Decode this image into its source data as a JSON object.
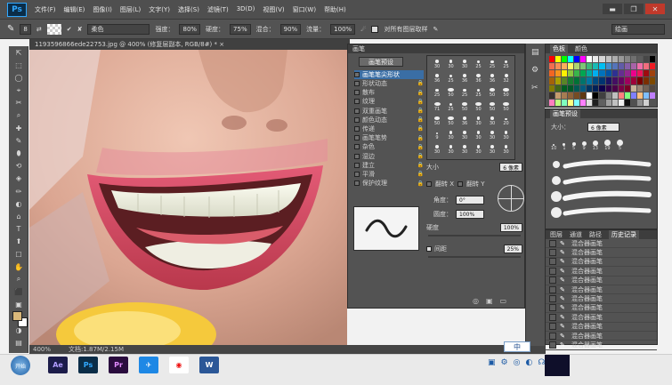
{
  "app": {
    "logo_text": "Ps"
  },
  "menu": [
    "文件(F)",
    "编辑(E)",
    "图像(I)",
    "图层(L)",
    "文字(Y)",
    "选择(S)",
    "滤镜(T)",
    "3D(D)",
    "视图(V)",
    "窗口(W)",
    "帮助(H)"
  ],
  "window_buttons": [
    "▬",
    "❐",
    "✕"
  ],
  "options_bar": {
    "preset_size": "8",
    "mode_value": "柔色",
    "opacity_label": "强度：",
    "opacity_value": "80%",
    "flow_label": "硬度：",
    "flow_value": "75%",
    "strength_label": "混合：",
    "strength_value": "90%",
    "blend_label": "流量：",
    "blend_value": "100%",
    "all_layers_label": "对所有图层取样",
    "workspace_value": "绘画"
  },
  "doc_tab": "1193596866ede22753.jpg @ 400% (修复层副本, RGB/8#) * ×",
  "status": {
    "zoom": "400%",
    "doc": "文档:1.87M/2.15M"
  },
  "brush_panel": {
    "tabs": "画笔",
    "preset_button": "画笔预设",
    "options": [
      {
        "label": "画笔笔尖形状",
        "selected": true,
        "lock": ""
      },
      {
        "label": "形状动态",
        "selected": false,
        "lock": "🔒"
      },
      {
        "label": "散布",
        "selected": false,
        "lock": "🔒"
      },
      {
        "label": "纹理",
        "selected": false,
        "lock": "🔒"
      },
      {
        "label": "双重画笔",
        "selected": false,
        "lock": "🔒"
      },
      {
        "label": "颜色动态",
        "selected": false,
        "lock": "🔒"
      },
      {
        "label": "传递",
        "selected": false,
        "lock": "🔒"
      },
      {
        "label": "画笔笔势",
        "selected": false,
        "lock": "🔒"
      },
      {
        "label": "杂色",
        "selected": false,
        "lock": "🔒"
      },
      {
        "label": "湿边",
        "selected": false,
        "lock": "🔒"
      },
      {
        "label": "建立",
        "selected": false,
        "lock": "🔒"
      },
      {
        "label": "平滑",
        "selected": false,
        "lock": "🔒"
      },
      {
        "label": "保护纹理",
        "selected": false,
        "lock": "🔒"
      }
    ],
    "tip_sizes": [
      "30",
      "30",
      "30",
      "25",
      "25",
      "25",
      "36",
      "25",
      "36",
      "36",
      "36",
      "32",
      "25",
      "50",
      "25",
      "25",
      "50",
      "50",
      "71",
      "25",
      "50",
      "50",
      "50",
      "50",
      "50",
      "50",
      "36",
      "30",
      "30",
      "20",
      "9",
      "30",
      "30",
      "30",
      "30",
      "30",
      "30",
      "30",
      "30",
      "30",
      "30",
      "30"
    ],
    "size_label": "大小",
    "size_value": "6 像素",
    "flip_x": "翻转 X",
    "flip_y": "翻转 Y",
    "angle_label": "角度：",
    "angle_value": "0°",
    "roundness_label": "圆度：",
    "roundness_value": "100%",
    "hardness_label": "硬度",
    "hardness_value": "100%",
    "spacing_label": "间距",
    "spacing_value": "25%"
  },
  "color_panel": {
    "tabs": [
      "色板",
      "颜色"
    ],
    "swatches": [
      "#ff0000",
      "#ffff00",
      "#00ff00",
      "#00ffff",
      "#0000ff",
      "#ff00ff",
      "#ffffff",
      "#ebebeb",
      "#d6d6d6",
      "#c2c2c2",
      "#adadad",
      "#999999",
      "#858585",
      "#707070",
      "#5c5c5c",
      "#474747",
      "#000000",
      "#f26c4f",
      "#f68e55",
      "#fbaf5c",
      "#fff467",
      "#acd372",
      "#7cc576",
      "#3bb878",
      "#1abbb4",
      "#00bff3",
      "#438ccb",
      "#5574b9",
      "#605ca8",
      "#855fa8",
      "#a763a8",
      "#f06ea9",
      "#f26d7d",
      "#ed1c24",
      "#f26522",
      "#f7941d",
      "#fff200",
      "#8dc63f",
      "#39b54a",
      "#00a651",
      "#00a99d",
      "#00aeef",
      "#0072bc",
      "#0054a6",
      "#2e3192",
      "#662d91",
      "#92278f",
      "#ec008c",
      "#ed145b",
      "#9e0b0f",
      "#a0410d",
      "#a36209",
      "#aba000",
      "#598527",
      "#1a7b30",
      "#007236",
      "#00746b",
      "#0076a3",
      "#004b80",
      "#003471",
      "#1b1464",
      "#440e62",
      "#630460",
      "#9e005d",
      "#9e0039",
      "#790000",
      "#7b2e00",
      "#7d4900",
      "#827b00",
      "#406618",
      "#005e20",
      "#005826",
      "#005952",
      "#005b7f",
      "#003663",
      "#002157",
      "#0d004c",
      "#32004b",
      "#4b0049",
      "#7b0046",
      "#7a0026",
      "#c7b299",
      "#998675",
      "#736357",
      "#534741",
      "#37302d",
      "#c69c6d",
      "#a67c52",
      "#8c6239",
      "#754c24",
      "#603913",
      "#ffffff",
      "#000000",
      "#404040",
      "#808080",
      "#bfbfbf",
      "#ff7f7f",
      "#7fff7f",
      "#7f7fff",
      "#ffbf7f",
      "#7fbfff",
      "#bf7fff",
      "#ff7fbf",
      "#bfff7f",
      "#7fffbf",
      "#ffff7f",
      "#7fffff",
      "#ff7fff",
      "#e0e0e0",
      "#202020",
      "#606060",
      "#a0a0a0",
      "#c0c0c0",
      "#f0f0f0",
      "#101010",
      "#505050",
      "#909090",
      "#d0d0d0"
    ]
  },
  "brush_presets_panel": {
    "tab": "画笔预设",
    "size_label": "大小：",
    "size_value": "6 像素",
    "tip_sizes": [
      "10",
      "1",
      "5",
      "9",
      "13",
      "19",
      "5"
    ]
  },
  "history_panel": {
    "tabs": [
      "图层",
      "通道",
      "路径",
      "历史记录"
    ],
    "items": [
      "混合器画笔",
      "混合器画笔",
      "混合器画笔",
      "混合器画笔",
      "混合器画笔",
      "混合器画笔",
      "混合器画笔",
      "混合器画笔",
      "混合器画笔",
      "混合器画笔",
      "混合器画笔",
      "混合器画笔"
    ]
  },
  "ime": "中",
  "taskbar": {
    "start": "开始",
    "apps": [
      {
        "name": "Ae",
        "color": "#1c1c4a",
        "fg": "#b19cff"
      },
      {
        "name": "Ps",
        "color": "#0b2d48",
        "fg": "#31a8ff"
      },
      {
        "name": "Pr",
        "color": "#2a0c3e",
        "fg": "#e28bff"
      },
      {
        "name": "✈",
        "color": "#1e88e5",
        "fg": "#ffffff"
      },
      {
        "name": "◉",
        "color": "#ffffff",
        "fg": "#e11"
      },
      {
        "name": "W",
        "color": "#2b5797",
        "fg": "#ffffff"
      }
    ],
    "tray": [
      "▣",
      "⚙",
      "◎",
      "◐",
      "☊"
    ]
  }
}
